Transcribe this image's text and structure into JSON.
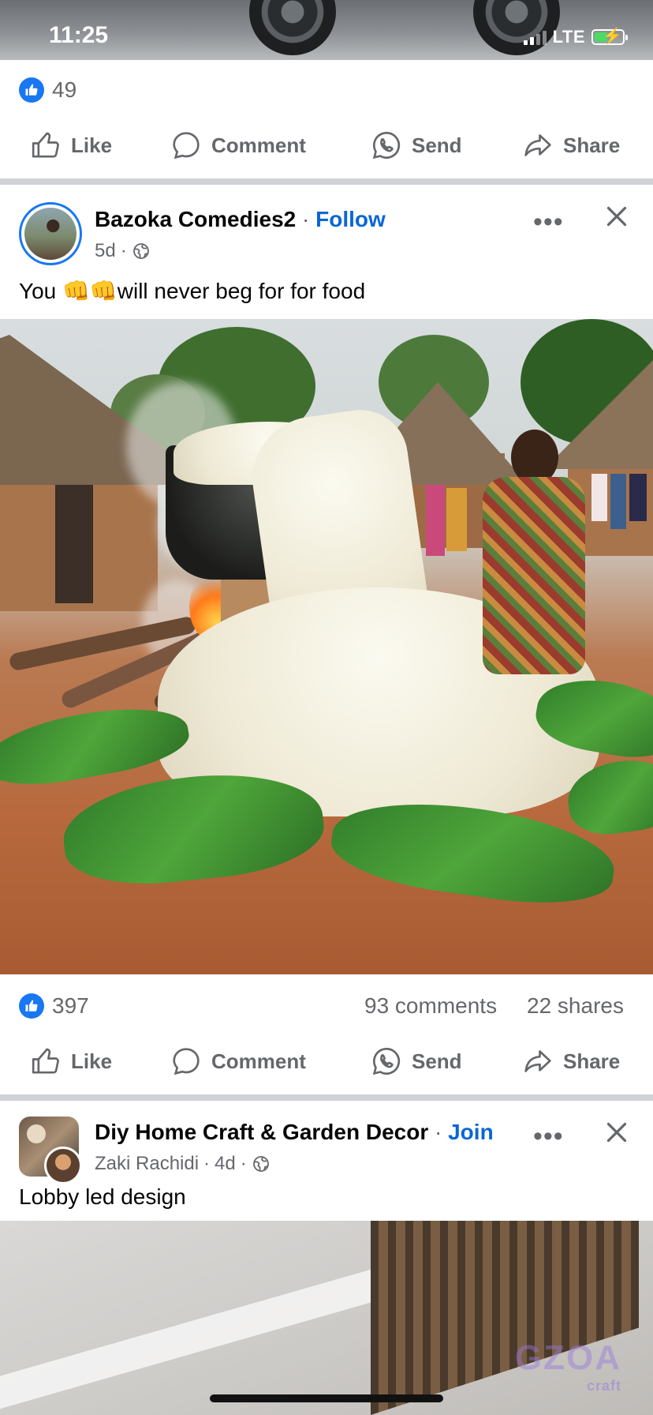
{
  "status_bar": {
    "time": "11:25",
    "network": "LTE"
  },
  "prev_post": {
    "like_count": "49",
    "actions": {
      "like": "Like",
      "comment": "Comment",
      "send": "Send",
      "share": "Share"
    }
  },
  "post1": {
    "page_name": "Bazoka Comedies2",
    "separator": "·",
    "follow_label": "Follow",
    "time": "5d",
    "text_before": "You ",
    "emoji": "👊👊",
    "text_after": "will never beg for for food",
    "like_count": "397",
    "comments": "93 comments",
    "shares": "22 shares",
    "actions": {
      "like": "Like",
      "comment": "Comment",
      "send": "Send",
      "share": "Share"
    }
  },
  "post2": {
    "group_name": "Diy Home Craft & Garden Decor",
    "separator": "·",
    "join_label": "Join",
    "author": "Zaki Rachidi",
    "time": "4d",
    "text": "Lobby led design",
    "watermark": "GZOA",
    "watermark_sub": "craft"
  },
  "colors": {
    "facebook_blue": "#1877f2",
    "link_blue": "#0a66d8",
    "secondary_text": "#65676b"
  }
}
